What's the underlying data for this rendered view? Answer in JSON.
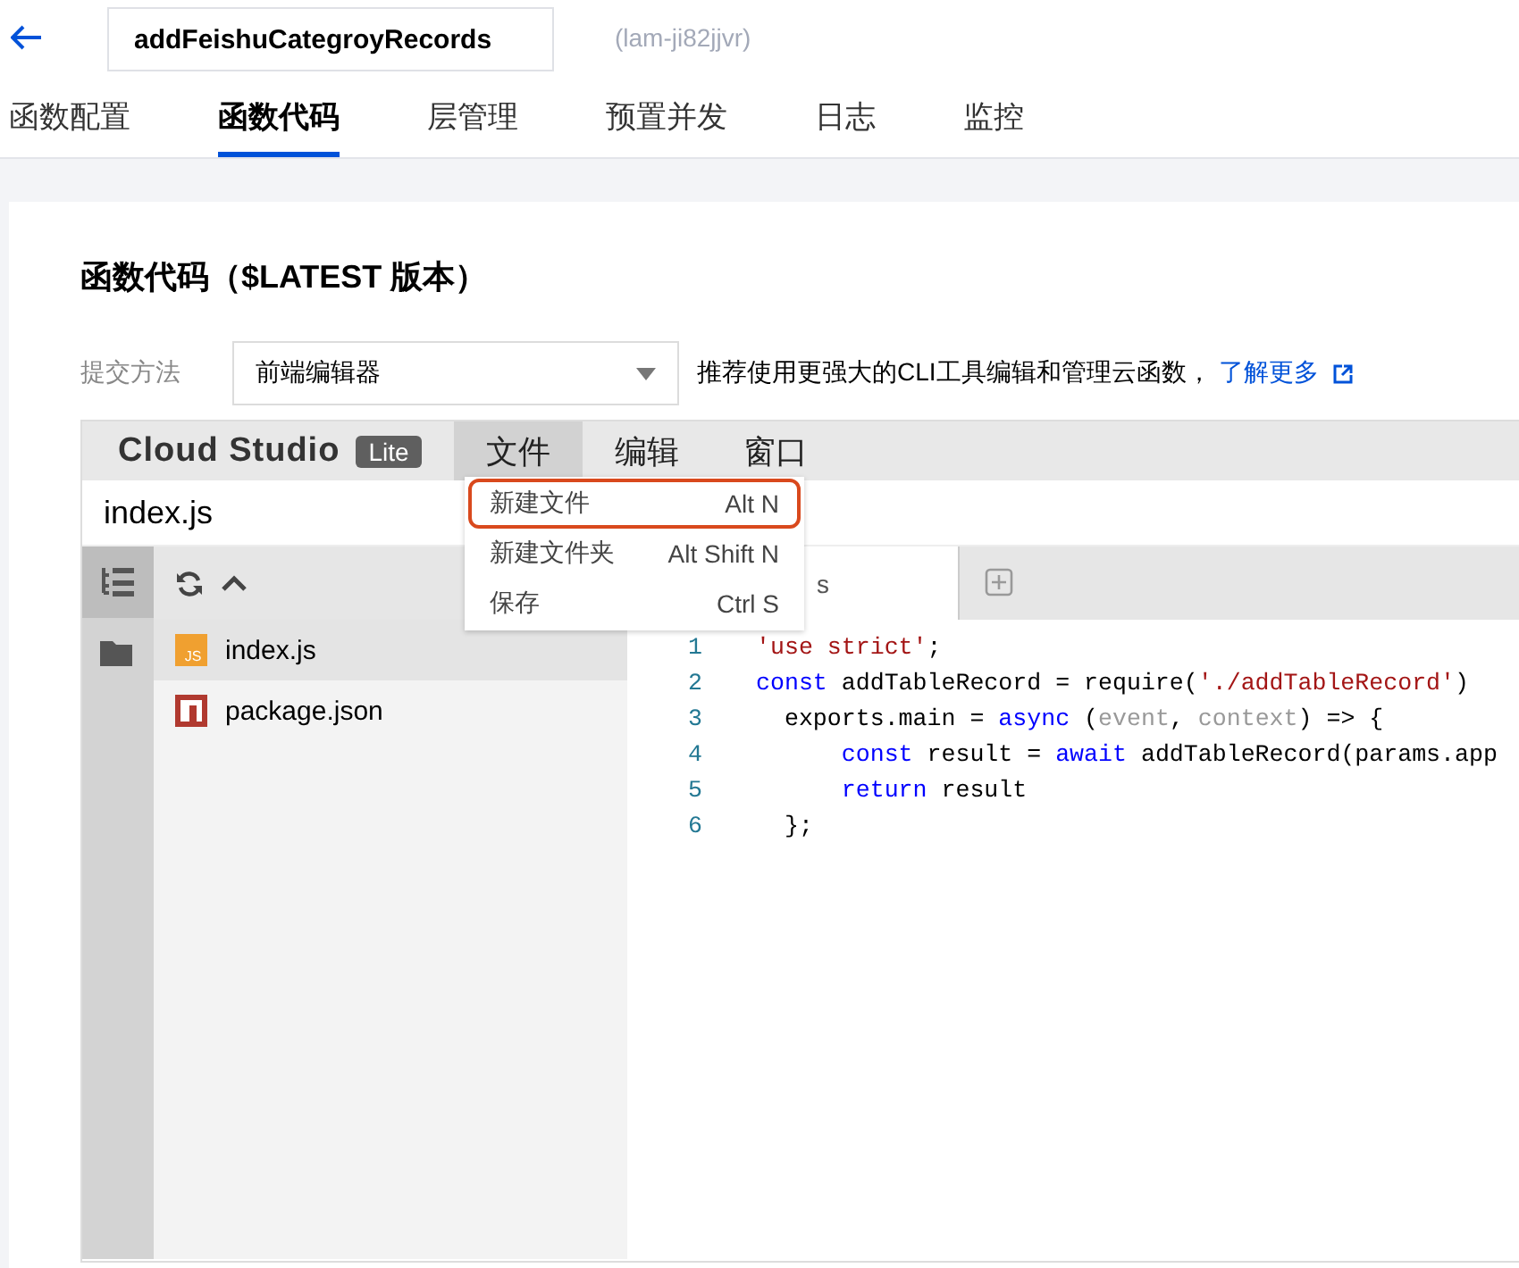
{
  "header": {
    "function_name": "addFeishuCategroyRecords",
    "function_id": "(lam-ji82jjvr)"
  },
  "tabs": [
    {
      "label": "函数配置",
      "selected": false
    },
    {
      "label": "函数代码",
      "selected": true
    },
    {
      "label": "层管理",
      "selected": false
    },
    {
      "label": "预置并发",
      "selected": false
    },
    {
      "label": "日志",
      "selected": false
    },
    {
      "label": "监控",
      "selected": false
    }
  ],
  "section_title": "函数代码（$LATEST 版本）",
  "submit": {
    "label": "提交方法",
    "value": "前端编辑器",
    "hint": "推荐使用更强大的CLI工具编辑和管理云函数，",
    "link": "了解更多"
  },
  "ide": {
    "brand": "Cloud Studio",
    "badge": "Lite",
    "menus": [
      {
        "label": "文件",
        "selected": true
      },
      {
        "label": "编辑",
        "selected": false
      },
      {
        "label": "窗口",
        "selected": false
      }
    ],
    "menu_items": [
      {
        "label": "新建文件",
        "shortcut": "Alt N",
        "highlighted": true
      },
      {
        "label": "新建文件夹",
        "shortcut": "Alt Shift N",
        "highlighted": false
      },
      {
        "label": "保存",
        "shortcut": "Ctrl S",
        "highlighted": false
      }
    ],
    "path": "index.js",
    "files": [
      {
        "name": "index.js",
        "kind": "script",
        "icon_text": "JS",
        "selected": true
      },
      {
        "name": "package.json",
        "kind": "package",
        "selected": false
      }
    ],
    "editor_tab": "s",
    "lines": [
      {
        "number": "1",
        "tokens": [
          {
            "text": "'use strict'",
            "kind": "string"
          },
          {
            "text": ";",
            "kind": "plain"
          }
        ]
      },
      {
        "number": "2",
        "tokens": [
          {
            "text": "const",
            "kind": "keyword"
          },
          {
            "text": " addTableRecord = require(",
            "kind": "plain"
          },
          {
            "text": "'./addTableRecord'",
            "kind": "string"
          },
          {
            "text": ")",
            "kind": "plain"
          }
        ]
      },
      {
        "number": "3",
        "tokens": [
          {
            "text": "  exports.main = ",
            "kind": "plain"
          },
          {
            "text": "async",
            "kind": "keyword"
          },
          {
            "text": " (",
            "kind": "plain"
          },
          {
            "text": "event",
            "kind": "param"
          },
          {
            "text": ", ",
            "kind": "plain"
          },
          {
            "text": "context",
            "kind": "param"
          },
          {
            "text": ") => {",
            "kind": "plain"
          }
        ]
      },
      {
        "number": "4",
        "tokens": [
          {
            "text": "      const",
            "kind": "keyword"
          },
          {
            "text": " result = ",
            "kind": "plain"
          },
          {
            "text": "await",
            "kind": "keyword"
          },
          {
            "text": " addTableRecord(params.app",
            "kind": "plain"
          }
        ]
      },
      {
        "number": "5",
        "tokens": [
          {
            "text": "      return",
            "kind": "keyword"
          },
          {
            "text": " result",
            "kind": "plain"
          }
        ]
      },
      {
        "number": "6",
        "tokens": [
          {
            "text": "  };",
            "kind": "plain"
          }
        ]
      }
    ]
  }
}
